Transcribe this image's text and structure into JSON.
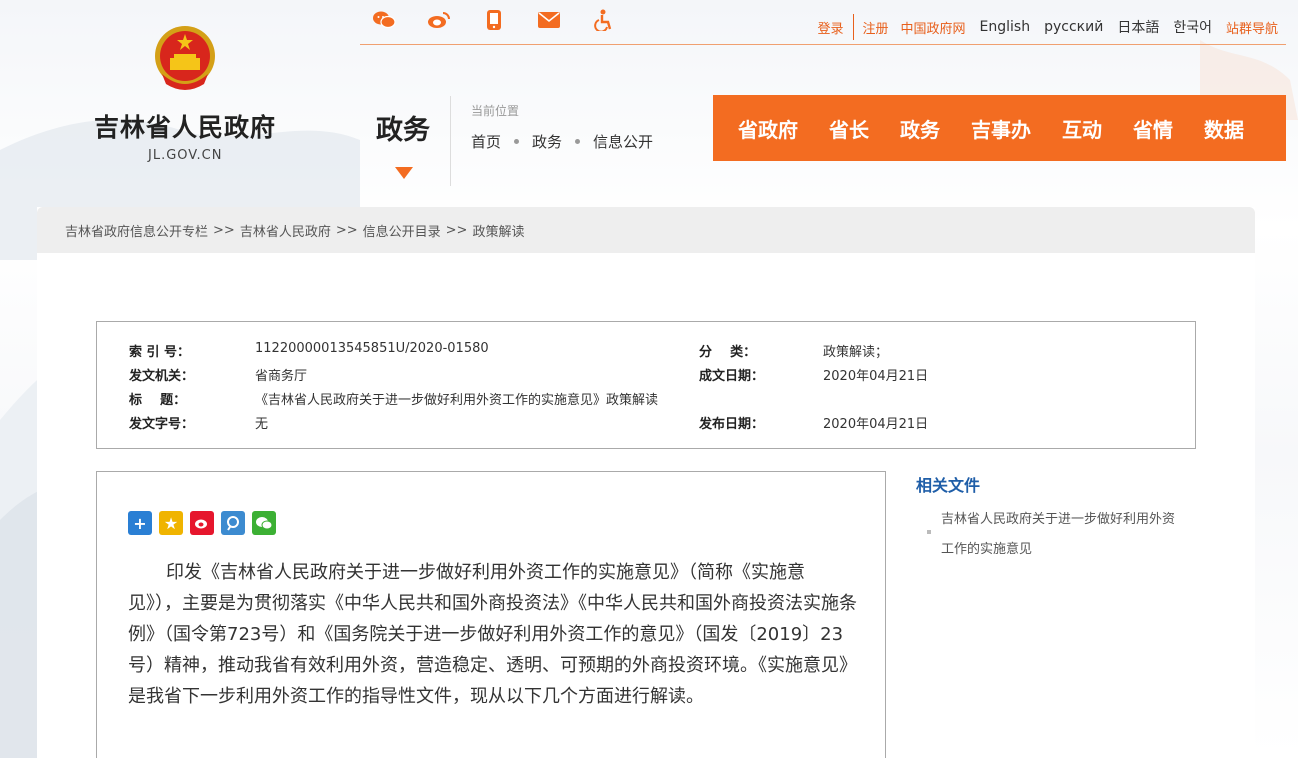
{
  "header": {
    "site_title": "吉林省人民政府",
    "site_domain": "JL.GOV.CN",
    "icons": [
      "wechat-icon",
      "weibo-icon",
      "mobile-icon",
      "mail-icon",
      "accessibility-icon"
    ],
    "login": "登录",
    "register": "注册",
    "gov_portal": "中国政府网",
    "languages": [
      "English",
      "русский",
      "日本語",
      "한국어"
    ],
    "site_nav": "站群导航"
  },
  "section": {
    "title": "政务",
    "location_label": "当前位置",
    "crumbs": [
      "首页",
      "政务",
      "信息公开"
    ]
  },
  "mainnav": [
    "省政府",
    "省长",
    "政务",
    "吉事办",
    "互动",
    "省情",
    "数据"
  ],
  "breadcrumb": [
    "吉林省政府信息公开专栏",
    "吉林省人民政府",
    "信息公开目录",
    "政策解读"
  ],
  "breadcrumb_sep": ">>",
  "meta": {
    "index_label": "索 引 号：",
    "index_value": "11220000013545851U/2020-01580",
    "category_label": "分    类：",
    "category_value": "政策解读；",
    "issuer_label": "发文机关：",
    "issuer_value": "省商务厅",
    "created_label": "成文日期：",
    "created_value": "2020年04月21日",
    "title_label": "标    题：",
    "title_value": "《吉林省人民政府关于进一步做好利用外资工作的实施意见》政策解读",
    "docno_label": "发文字号：",
    "docno_value": "无",
    "published_label": "发布日期：",
    "published_value": "2020年04月21日"
  },
  "share_icons": [
    "share-more-icon",
    "qzone-icon",
    "weibo-share-icon",
    "tencent-weibo-icon",
    "wechat-share-icon"
  ],
  "article": {
    "paragraph": "印发《吉林省人民政府关于进一步做好利用外资工作的实施意见》（简称《实施意见》），主要是为贯彻落实《中华人民共和国外商投资法》《中华人民共和国外商投资法实施条例》（国令第723号）和《国务院关于进一步做好利用外资工作的意见》（国发〔2019〕23号）精神，推动我省有效利用外资，营造稳定、透明、可预期的外商投资环境。《实施意见》是我省下一步利用外资工作的指导性文件，现从以下几个方面进行解读。"
  },
  "related": {
    "title": "相关文件",
    "items": [
      "吉林省人民政府关于进一步做好利用外资工作的实施意见"
    ]
  },
  "colors": {
    "accent": "#f36c21",
    "link_blue": "#1f5ea8"
  }
}
